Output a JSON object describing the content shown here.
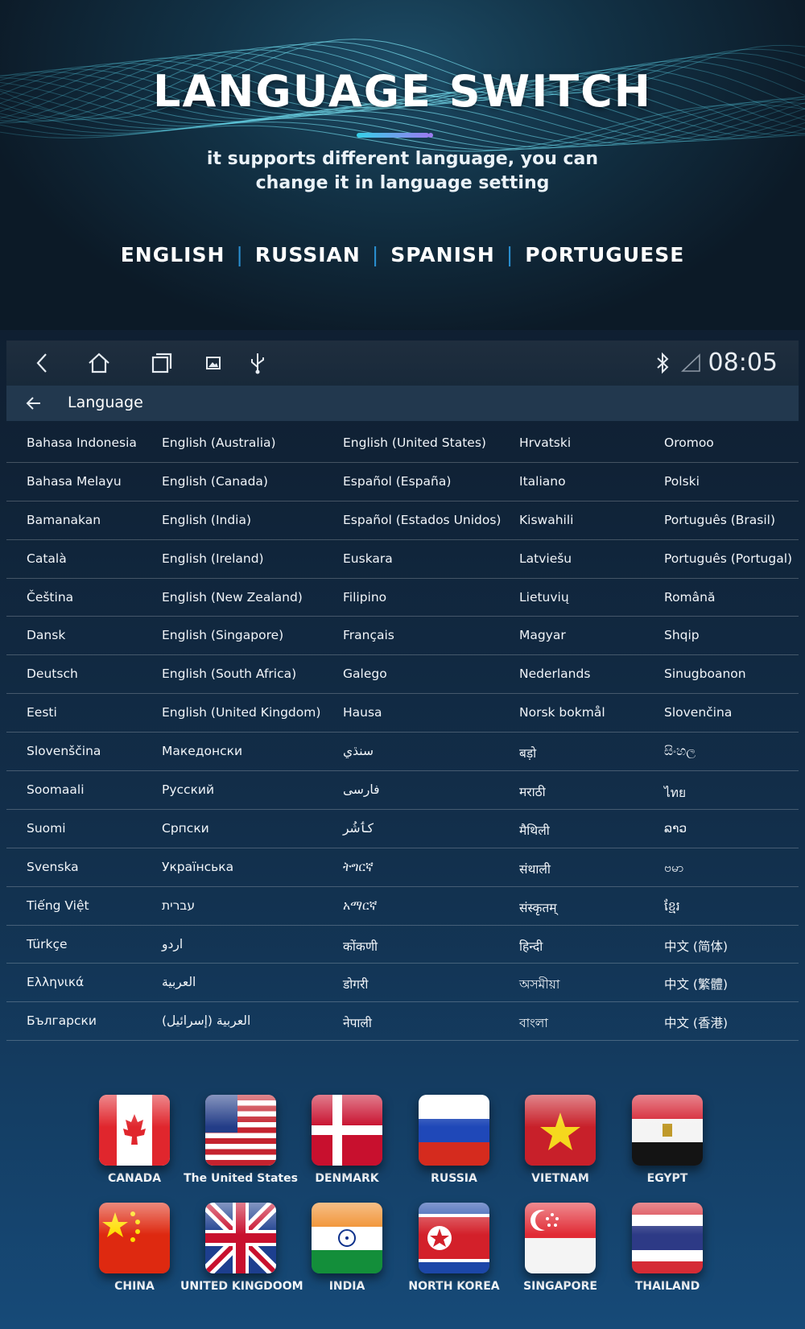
{
  "hero": {
    "title": "LANGUAGE SWITCH",
    "subtitle_line1": "it supports different language, you can",
    "subtitle_line2": "change it in language setting",
    "languages": [
      "ENGLISH",
      "RUSSIAN",
      "SPANISH",
      "PORTUGUESE"
    ]
  },
  "statusbar": {
    "time": "08:05",
    "icons": [
      "back-icon",
      "home-icon",
      "recent-apps-icon",
      "gallery-icon",
      "usb-icon",
      "bluetooth-icon",
      "signal-icon"
    ]
  },
  "settings": {
    "title": "Language",
    "rows": [
      [
        "Bahasa Indonesia",
        "English (Australia)",
        "English (United States)",
        "Hrvatski",
        "Oromoo"
      ],
      [
        "Bahasa Melayu",
        "English (Canada)",
        "Español (España)",
        "Italiano",
        "Polski"
      ],
      [
        "Bamanakan",
        "English (India)",
        "Español (Estados Unidos)",
        "Kiswahili",
        "Português (Brasil)"
      ],
      [
        "Català",
        "English (Ireland)",
        "Euskara",
        "Latviešu",
        "Português (Portugal)"
      ],
      [
        "Čeština",
        "English (New Zealand)",
        "Filipino",
        "Lietuvių",
        "Română"
      ],
      [
        "Dansk",
        "English (Singapore)",
        "Français",
        "Magyar",
        "Shqip"
      ],
      [
        "Deutsch",
        "English (South Africa)",
        "Galego",
        "Nederlands",
        "Sinugboanon"
      ],
      [
        "Eesti",
        "English (United Kingdom)",
        "Hausa",
        "Norsk bokmål",
        "Slovenčina"
      ],
      [
        "Slovenščina",
        "Македонски",
        "سنڌي",
        "बड़ो",
        "සිංහල"
      ],
      [
        "Soomaali",
        "Русский",
        "فارسی",
        "मराठी",
        "ไทย"
      ],
      [
        "Suomi",
        "Српски",
        "کٲشُر",
        "मैथिली",
        "ລາວ"
      ],
      [
        "Svenska",
        "Українська",
        "ትግርኛ",
        "संथाली",
        "ဗမာ"
      ],
      [
        "Tiếng Việt",
        "עברית",
        "አማርኛ",
        "संस्कृतम्",
        "ខ្មែរ"
      ],
      [
        "Türkçe",
        "اردو",
        "कोंकणी",
        "हिन्दी",
        "中文 (简体)"
      ],
      [
        "Ελληνικά",
        "العربية",
        "डोगरी",
        "অসমীয়া",
        "中文 (繁體)"
      ],
      [
        "Български",
        "العربية (إسرائيل)",
        "नेपाली",
        "বাংলা",
        "中文 (香港)"
      ]
    ]
  },
  "flags": [
    {
      "label": "CANADA",
      "icon": "canada-flag-icon"
    },
    {
      "label": "The United States",
      "icon": "usa-flag-icon"
    },
    {
      "label": "DENMARK",
      "icon": "denmark-flag-icon"
    },
    {
      "label": "RUSSIA",
      "icon": "russia-flag-icon"
    },
    {
      "label": "VIETNAM",
      "icon": "vietnam-flag-icon"
    },
    {
      "label": "EGYPT",
      "icon": "egypt-flag-icon"
    },
    {
      "label": "CHINA",
      "icon": "china-flag-icon"
    },
    {
      "label": "UNITED KINGDOOM",
      "icon": "uk-flag-icon"
    },
    {
      "label": "INDIA",
      "icon": "india-flag-icon"
    },
    {
      "label": "NORTH KOREA",
      "icon": "north-korea-flag-icon"
    },
    {
      "label": "SINGAPORE",
      "icon": "singapore-flag-icon"
    },
    {
      "label": "THAILAND",
      "icon": "thailand-flag-icon"
    }
  ],
  "colors": {
    "accent_blue": "#2a8fd0",
    "title_bar_cyan": "#35d0e8",
    "title_bar_violet": "#9a7cf0"
  }
}
